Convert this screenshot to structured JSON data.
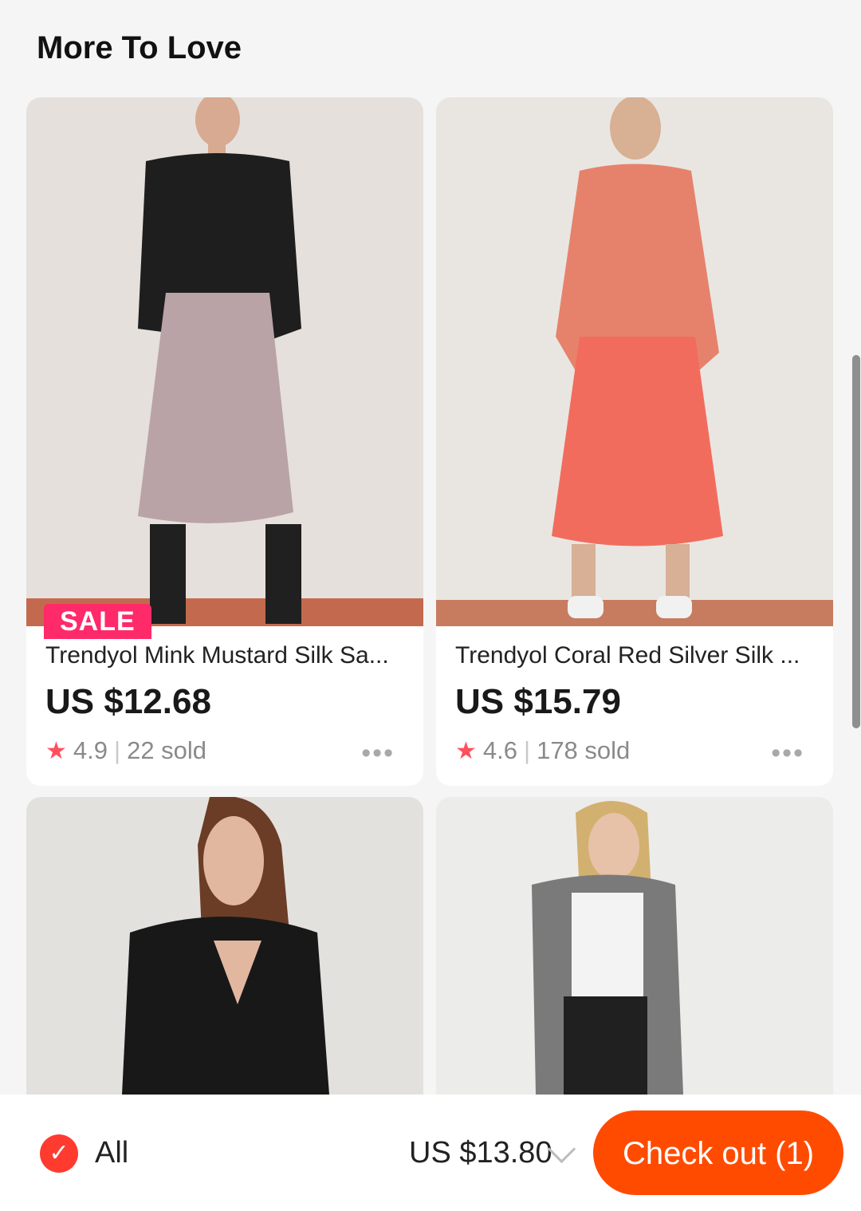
{
  "section_title": "More To Love",
  "products": [
    {
      "badge": "SALE",
      "title": "Trendyol Mink Mustard Silk Sa...",
      "price": "US $12.68",
      "rating": "4.9",
      "sold": "22 sold",
      "more": "•••"
    },
    {
      "badge": "",
      "title": "Trendyol  Coral Red Silver Silk ...",
      "price": "US $15.79",
      "rating": "4.6",
      "sold": "178 sold",
      "more": "•••"
    }
  ],
  "product_images": [
    {
      "name": "product-image-1",
      "colors": {
        "bg": "#e6e0dc",
        "top": "#1e1e1e",
        "skirt": "#b9a3a6",
        "floor": "#c36a4e"
      }
    },
    {
      "name": "product-image-2",
      "colors": {
        "bg": "#e9e6e2",
        "top": "#e6826b",
        "skirt": "#f26c5e",
        "floor": "#c77b5f"
      }
    },
    {
      "name": "product-image-3",
      "colors": {
        "bg": "#e3e1de",
        "top": "#181818"
      }
    },
    {
      "name": "product-image-4",
      "colors": {
        "bg": "#ececea",
        "top": "#7a7a7a",
        "tshirt": "#f3f3f3"
      }
    }
  ],
  "bottom_bar": {
    "all_label": "All",
    "total": "US $13.80",
    "checkout_label": "Check out (1)"
  },
  "colors": {
    "accent": "#ff4b00",
    "sale": "#ff2a6a",
    "star": "#ff4f5e"
  }
}
